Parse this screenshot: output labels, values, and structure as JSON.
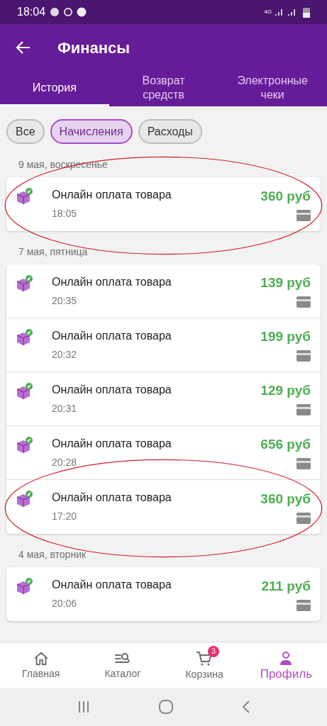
{
  "status_bar": {
    "time": "18:04",
    "network": "4G"
  },
  "header": {
    "title": "Финансы"
  },
  "tabs": [
    {
      "label": "История",
      "selected": true
    },
    {
      "label": "Возврат средств",
      "selected": false
    },
    {
      "label": "Электронные чеки",
      "selected": false
    }
  ],
  "filters": [
    {
      "label": "Все",
      "selected": false
    },
    {
      "label": "Начисления",
      "selected": true
    },
    {
      "label": "Расходы",
      "selected": false
    }
  ],
  "groups": [
    {
      "date": "9 мая, воскресенье",
      "items": [
        {
          "title": "Онлайн оплата товара",
          "time": "18:05",
          "amount": "360 руб",
          "circled": true
        }
      ]
    },
    {
      "date": "7 мая, пятница",
      "items": [
        {
          "title": "Онлайн оплата товара",
          "time": "20:35",
          "amount": "139 руб",
          "circled": false
        },
        {
          "title": "Онлайн оплата товара",
          "time": "20:32",
          "amount": "199 руб",
          "circled": false
        },
        {
          "title": "Онлайн оплата товара",
          "time": "20:31",
          "amount": "129 руб",
          "circled": false
        },
        {
          "title": "Онлайн оплата товара",
          "time": "20:28",
          "amount": "656 руб",
          "circled": false
        },
        {
          "title": "Онлайн оплата товара",
          "time": "17:20",
          "amount": "360 руб",
          "circled": true
        }
      ]
    },
    {
      "date": "4 мая, вторник",
      "items": [
        {
          "title": "Онлайн оплата товара",
          "time": "20:06",
          "amount": "211 руб",
          "circled": false
        }
      ]
    }
  ],
  "bottom_nav": [
    {
      "kind": "home",
      "label": "Главная",
      "selected": false
    },
    {
      "kind": "catalog",
      "label": "Каталог",
      "selected": false
    },
    {
      "kind": "cart",
      "label": "Корзина",
      "selected": false,
      "badge": "3"
    },
    {
      "kind": "profile",
      "label": "Профиль",
      "selected": true
    }
  ]
}
